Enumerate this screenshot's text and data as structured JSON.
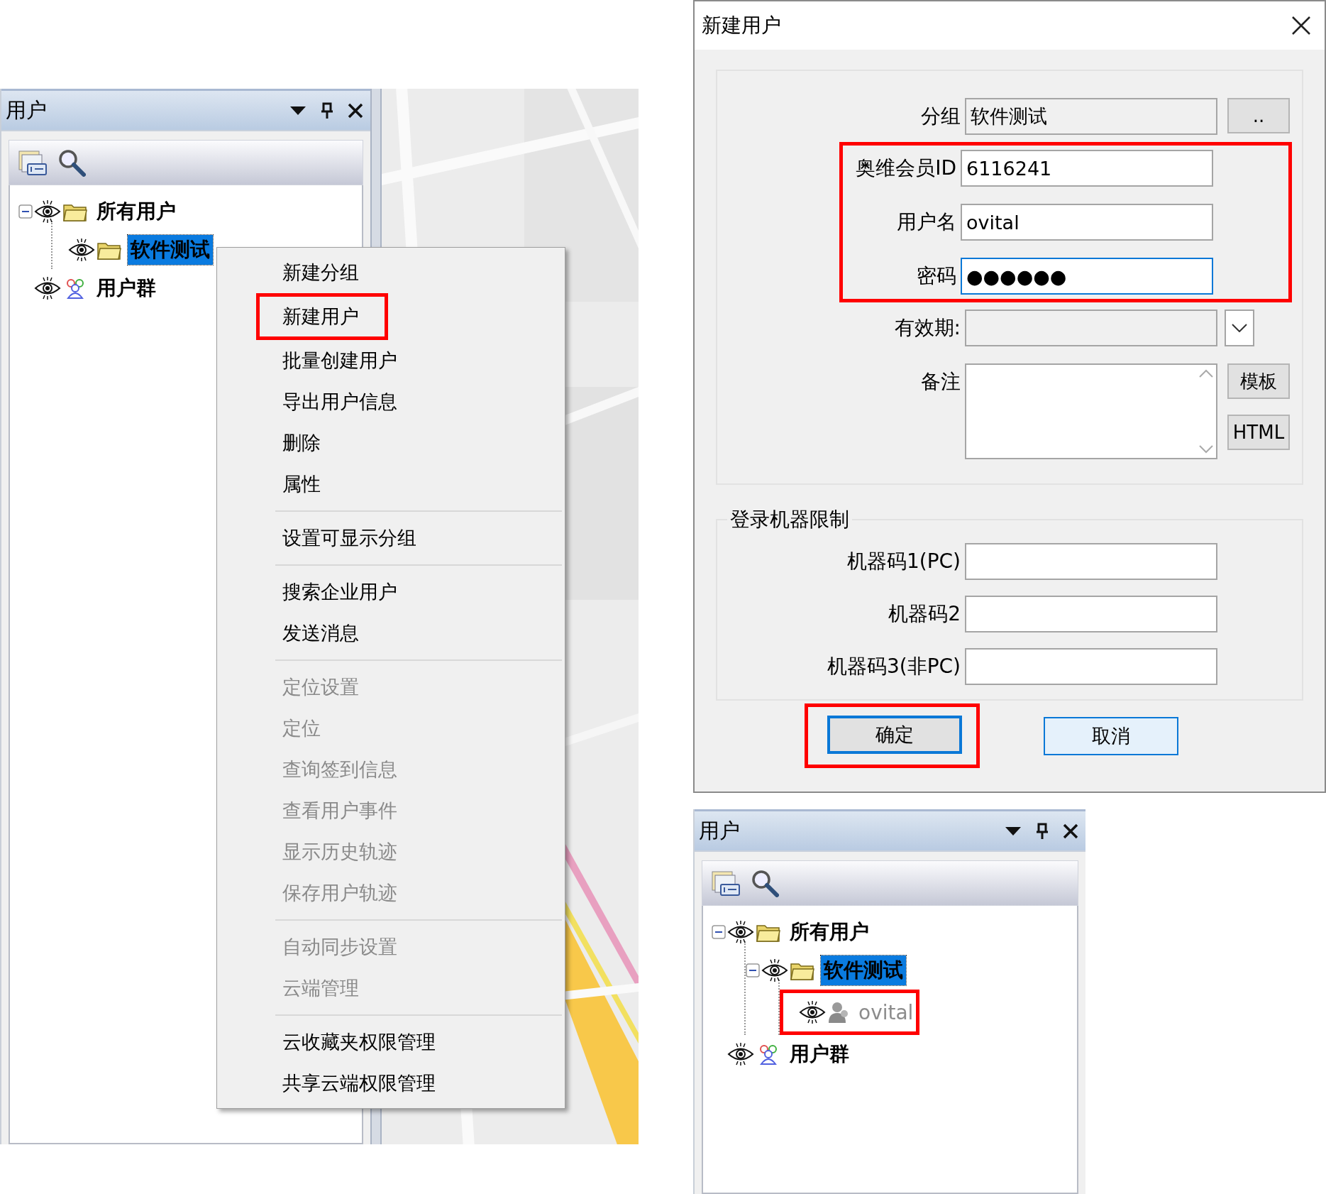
{
  "left_panel": {
    "title": "用户",
    "tree": [
      {
        "label": "所有用户",
        "kind": "folder",
        "expanded": true,
        "selected": false,
        "highlighted": false,
        "children": [
          {
            "label": "软件测试",
            "kind": "folder",
            "selected": true,
            "highlighted": false
          }
        ]
      },
      {
        "label": "用户群",
        "kind": "user_group",
        "selected": false,
        "highlighted": false
      }
    ]
  },
  "context_menu": {
    "groups": [
      [
        {
          "label": "新建分组",
          "disabled": false,
          "highlighted": false
        },
        {
          "label": "新建用户",
          "disabled": false,
          "highlighted": true
        },
        {
          "label": "批量创建用户",
          "disabled": false,
          "highlighted": false
        },
        {
          "label": "导出用户信息",
          "disabled": false,
          "highlighted": false
        },
        {
          "label": "删除",
          "disabled": false,
          "highlighted": false
        },
        {
          "label": "属性",
          "disabled": false,
          "highlighted": false
        }
      ],
      [
        {
          "label": "设置可显示分组",
          "disabled": false,
          "highlighted": false
        }
      ],
      [
        {
          "label": "搜索企业用户",
          "disabled": false,
          "highlighted": false
        },
        {
          "label": "发送消息",
          "disabled": false,
          "highlighted": false
        }
      ],
      [
        {
          "label": "定位设置",
          "disabled": true,
          "highlighted": false
        },
        {
          "label": "定位",
          "disabled": true,
          "highlighted": false
        },
        {
          "label": "查询签到信息",
          "disabled": true,
          "highlighted": false
        },
        {
          "label": "查看用户事件",
          "disabled": true,
          "highlighted": false
        },
        {
          "label": "显示历史轨迹",
          "disabled": true,
          "highlighted": false
        },
        {
          "label": "保存用户轨迹",
          "disabled": true,
          "highlighted": false
        }
      ],
      [
        {
          "label": "自动同步设置",
          "disabled": true,
          "highlighted": false
        },
        {
          "label": "云端管理",
          "disabled": true,
          "highlighted": false
        }
      ],
      [
        {
          "label": "云收藏夹权限管理",
          "disabled": false,
          "highlighted": false
        },
        {
          "label": "共享云端权限管理",
          "disabled": false,
          "highlighted": false
        }
      ]
    ]
  },
  "dialog": {
    "title": "新建用户",
    "fields": [
      {
        "kind": "picker",
        "label": "分组",
        "value": "软件测试",
        "button": "..",
        "highlighted": false
      },
      {
        "kind": "text",
        "label": "奥维会员ID",
        "value": "6116241",
        "highlighted": true,
        "focused": false
      },
      {
        "kind": "text",
        "label": "用户名",
        "value": "ovital",
        "highlighted": true,
        "focused": false
      },
      {
        "kind": "password",
        "label": "密码",
        "value": "●●●●●●",
        "highlighted": true,
        "focused": true
      },
      {
        "kind": "date",
        "label": "有效期:",
        "highlighted": false
      },
      {
        "kind": "memo",
        "label": "备注",
        "buttons": [
          "模板",
          "HTML"
        ],
        "highlighted": false
      }
    ],
    "machine_group": {
      "title": "登录机器限制",
      "fields": [
        {
          "label": "机器码1(PC)"
        },
        {
          "label": "机器码2"
        },
        {
          "label": "机器码3(非PC)"
        }
      ]
    },
    "buttons": [
      {
        "label": "确定",
        "default": true,
        "highlighted": true
      },
      {
        "label": "取消",
        "default": false,
        "highlighted": false
      }
    ]
  },
  "bottom_panel": {
    "title": "用户",
    "tree": [
      {
        "label": "所有用户",
        "kind": "folder",
        "expanded": true,
        "selected": false,
        "highlighted": false,
        "children": [
          {
            "label": "软件测试",
            "kind": "folder",
            "expanded": true,
            "selected": true,
            "highlighted": false,
            "children": [
              {
                "label": "ovital",
                "kind": "user",
                "selected": false,
                "highlighted": true
              }
            ]
          }
        ]
      },
      {
        "label": "用户群",
        "kind": "user_group",
        "selected": false,
        "highlighted": false
      }
    ]
  }
}
